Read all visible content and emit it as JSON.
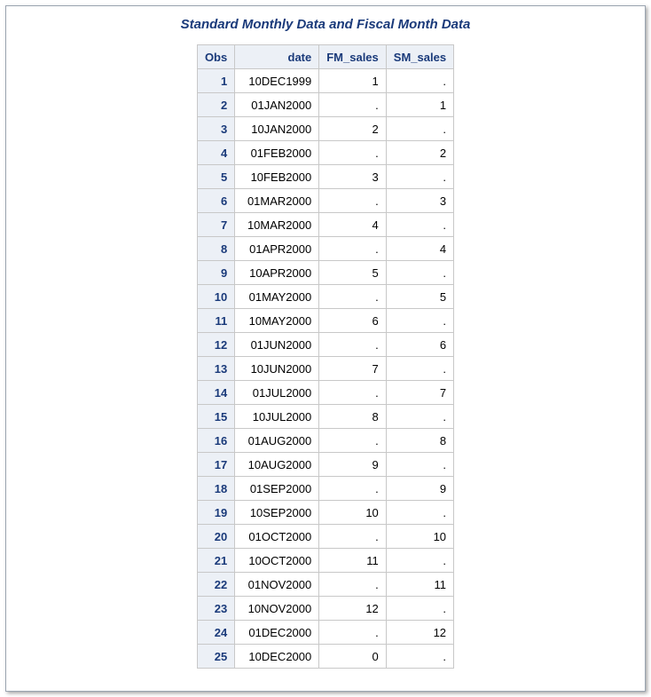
{
  "title": "Standard Monthly Data and Fiscal Month Data",
  "columns": [
    "Obs",
    "date",
    "FM_sales",
    "SM_sales"
  ],
  "rows": [
    {
      "obs": "1",
      "date": "10DEC1999",
      "fm": "1",
      "sm": "."
    },
    {
      "obs": "2",
      "date": "01JAN2000",
      "fm": ".",
      "sm": "1"
    },
    {
      "obs": "3",
      "date": "10JAN2000",
      "fm": "2",
      "sm": "."
    },
    {
      "obs": "4",
      "date": "01FEB2000",
      "fm": ".",
      "sm": "2"
    },
    {
      "obs": "5",
      "date": "10FEB2000",
      "fm": "3",
      "sm": "."
    },
    {
      "obs": "6",
      "date": "01MAR2000",
      "fm": ".",
      "sm": "3"
    },
    {
      "obs": "7",
      "date": "10MAR2000",
      "fm": "4",
      "sm": "."
    },
    {
      "obs": "8",
      "date": "01APR2000",
      "fm": ".",
      "sm": "4"
    },
    {
      "obs": "9",
      "date": "10APR2000",
      "fm": "5",
      "sm": "."
    },
    {
      "obs": "10",
      "date": "01MAY2000",
      "fm": ".",
      "sm": "5"
    },
    {
      "obs": "11",
      "date": "10MAY2000",
      "fm": "6",
      "sm": "."
    },
    {
      "obs": "12",
      "date": "01JUN2000",
      "fm": ".",
      "sm": "6"
    },
    {
      "obs": "13",
      "date": "10JUN2000",
      "fm": "7",
      "sm": "."
    },
    {
      "obs": "14",
      "date": "01JUL2000",
      "fm": ".",
      "sm": "7"
    },
    {
      "obs": "15",
      "date": "10JUL2000",
      "fm": "8",
      "sm": "."
    },
    {
      "obs": "16",
      "date": "01AUG2000",
      "fm": ".",
      "sm": "8"
    },
    {
      "obs": "17",
      "date": "10AUG2000",
      "fm": "9",
      "sm": "."
    },
    {
      "obs": "18",
      "date": "01SEP2000",
      "fm": ".",
      "sm": "9"
    },
    {
      "obs": "19",
      "date": "10SEP2000",
      "fm": "10",
      "sm": "."
    },
    {
      "obs": "20",
      "date": "01OCT2000",
      "fm": ".",
      "sm": "10"
    },
    {
      "obs": "21",
      "date": "10OCT2000",
      "fm": "11",
      "sm": "."
    },
    {
      "obs": "22",
      "date": "01NOV2000",
      "fm": ".",
      "sm": "11"
    },
    {
      "obs": "23",
      "date": "10NOV2000",
      "fm": "12",
      "sm": "."
    },
    {
      "obs": "24",
      "date": "01DEC2000",
      "fm": ".",
      "sm": "12"
    },
    {
      "obs": "25",
      "date": "10DEC2000",
      "fm": "0",
      "sm": "."
    }
  ]
}
